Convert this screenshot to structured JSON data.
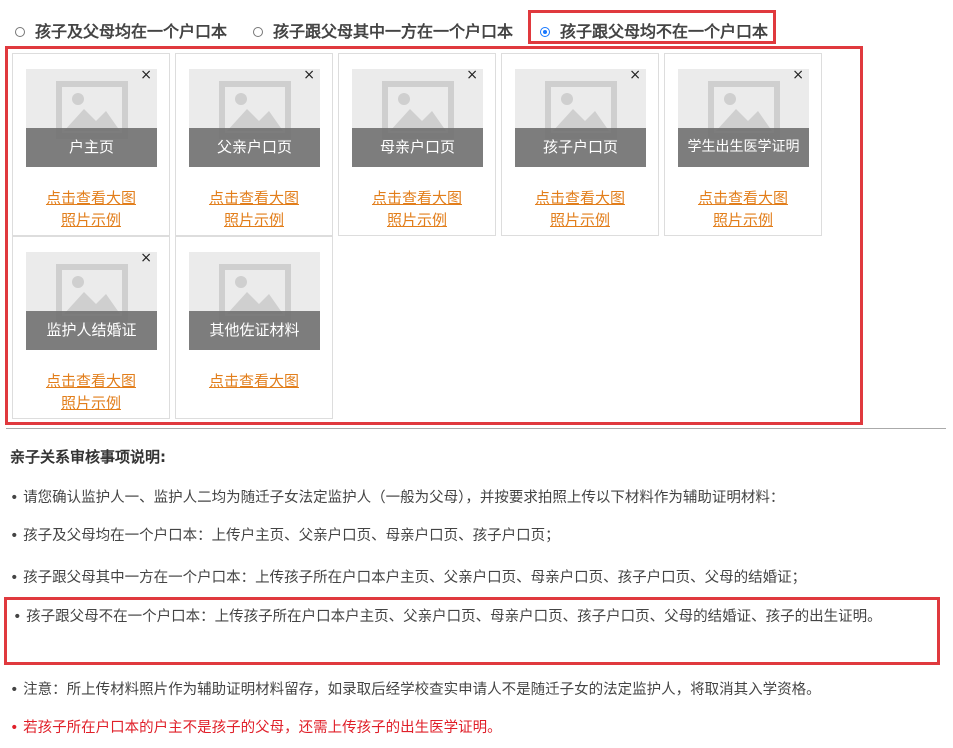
{
  "radios": [
    {
      "label": "孩子及父母均在一个户口本",
      "checked": false
    },
    {
      "label": "孩子跟父母其中一方在一个户口本",
      "checked": false
    },
    {
      "label": "孩子跟父母均不在一个户口本",
      "checked": true
    }
  ],
  "upload_cards": [
    {
      "caption": "户主页",
      "view_link": "点击查看大图",
      "example_link": "照片示例"
    },
    {
      "caption": "父亲户口页",
      "view_link": "点击查看大图",
      "example_link": "照片示例"
    },
    {
      "caption": "母亲户口页",
      "view_link": "点击查看大图",
      "example_link": "照片示例"
    },
    {
      "caption": "孩子户口页",
      "view_link": "点击查看大图",
      "example_link": "照片示例"
    },
    {
      "caption": "学生出生医学证明",
      "view_link": "点击查看大图",
      "example_link": "照片示例"
    },
    {
      "caption": "监护人结婚证",
      "view_link": "点击查看大图",
      "example_link": "照片示例"
    },
    {
      "caption": "其他佐证材料",
      "view_link": "点击查看大图",
      "example_link": null
    }
  ],
  "close_symbol": "×",
  "notes": {
    "title": "亲子关系审核事项说明:",
    "items": [
      "• 请您确认监护人一、监护人二均为随迁子女法定监护人（一般为父母），并按要求拍照上传以下材料作为辅助证明材料：",
      "• 孩子及父母均在一个户口本：上传户主页、父亲户口页、母亲户口页、孩子户口页；",
      "• 孩子跟父母其中一方在一个户口本：上传孩子所在户口本户主页、父亲户口页、母亲户口页、孩子户口页、父母的结婚证；",
      "• 孩子跟父母不在一个户口本：上传孩子所在户口本户主页、父亲户口页、母亲户口页、孩子户口页、父母的结婚证、孩子的出生证明。",
      "• 注意：所上传材料照片作为辅助证明材料留存，如录取后经学校查实申请人不是随迁子女的法定监护人，将取消其入学资格。",
      "• 若孩子所在户口本的户主不是孩子的父母，还需上传孩子的出生医学证明。"
    ]
  },
  "colors": {
    "highlight": "#e0393e",
    "link": "#e27e1b",
    "warning": "#e0202a",
    "radio_accent": "#1677ff"
  },
  "icons": {
    "placeholder": "image-placeholder-icon",
    "close": "close-icon"
  }
}
